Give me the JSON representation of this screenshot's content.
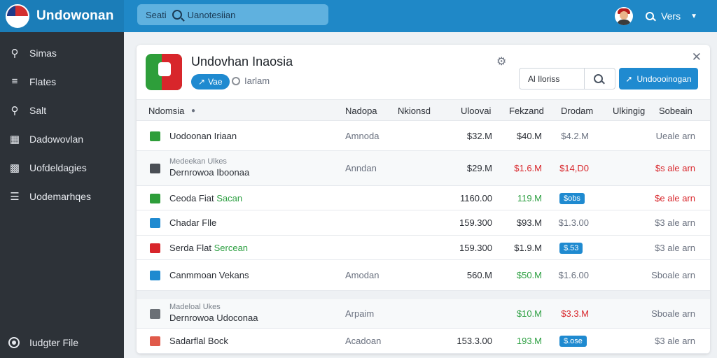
{
  "app": {
    "brand": "Undowonan"
  },
  "search": {
    "label": "Seati",
    "placeholder": "Uanotesiian"
  },
  "topbar": {
    "vers_label": "Vers"
  },
  "sidebar": {
    "items": [
      {
        "label": "Simas",
        "icon": "search-icon"
      },
      {
        "label": "Flates",
        "icon": "bars-icon"
      },
      {
        "label": "Salt",
        "icon": "key-icon"
      },
      {
        "label": "Dadowovlan",
        "icon": "book-icon"
      },
      {
        "label": "Uofdeldagies",
        "icon": "people-icon"
      },
      {
        "label": "Uodemarhqes",
        "icon": "menu-icon"
      }
    ],
    "footer": "Iudgter File"
  },
  "panel": {
    "title": "Undovhan Inaosia",
    "vae_button": "Vae",
    "extra_label": "Iarlam",
    "search_placeholder": "Al Iloriss",
    "primary_button": "Undoooinogan"
  },
  "table": {
    "columns": [
      "Ndomsia",
      "Nadopa",
      "Nkionsd",
      "Uloovai",
      "Fekzand",
      "Drodam",
      "Ulkingig",
      "Sobeain"
    ],
    "rows": [
      {
        "icon": "flag-icon",
        "icon_color": "#2e9e3a",
        "name": "Uodoonan",
        "name_hl": "Iriaan",
        "sub": "",
        "src": "Amnoda",
        "v1": "$32.M",
        "v2": "$40.M",
        "v2_class": "num",
        "v3": "$4.2.M",
        "v3_pill": false,
        "v3_class": "grey",
        "status": "Ueale arn",
        "status_red": false
      },
      {
        "icon": "square-icon",
        "icon_color": "#4a4f55",
        "name": "Dernrowoa Iboonaa",
        "name_hl": "",
        "sub": "Medeekan Ulkes",
        "src": "Anndan",
        "v1": "$29.M",
        "v2": "$1.6.M",
        "v2_class": "red",
        "v3": "$14,D0",
        "v3_pill": false,
        "v3_class": "red",
        "status": "$s ale arn",
        "status_red": true
      },
      {
        "icon": "flag-icon",
        "icon_color": "#2e9e3a",
        "name": "Ceoda Fiat",
        "name_hl": "Sacan",
        "sub": "",
        "src": "",
        "v1": "1160.00",
        "v2": "119.M",
        "v2_class": "green",
        "v3": "$obs",
        "v3_pill": true,
        "v3_class": "",
        "status": "$e ale arn",
        "status_red": true
      },
      {
        "icon": "image-icon",
        "icon_color": "#1f8ad0",
        "name": "Chadar Flle",
        "name_hl": "",
        "sub": "",
        "src": "",
        "v1": "159.300",
        "v2": "$93.M",
        "v2_class": "num",
        "v3": "$1.3.00",
        "v3_pill": false,
        "v3_class": "grey",
        "status": "$3 ale arn",
        "status_red": false
      },
      {
        "icon": "circle-icon",
        "icon_color": "#d8262b",
        "name": "Serda Flat",
        "name_hl": "Sercean",
        "sub": "",
        "src": "",
        "v1": "159.300",
        "v2": "$1.9.M",
        "v2_class": "num",
        "v3": "$.53",
        "v3_pill": true,
        "v3_class": "",
        "status": "$3 ale arn",
        "status_red": false
      },
      {
        "icon": "card-icon",
        "icon_color": "#1f8ad0",
        "name": "Canmmoan Vekans",
        "name_hl": "",
        "sub": "",
        "src": "Amodan",
        "v1": "560.M",
        "v2": "$50.M",
        "v2_class": "green",
        "v3": "$1.6.00",
        "v3_pill": false,
        "v3_class": "grey",
        "status": "Sboale arn",
        "status_red": false
      },
      {
        "icon": "square-icon",
        "icon_color": "#6b7076",
        "name": "Dernrowoa Udoconaa",
        "name_hl": "",
        "sub": "Madeloal Ukes",
        "src": "Arpaim",
        "v1": "",
        "v2": "$10.M",
        "v2_class": "green",
        "v3": "$3.3.M",
        "v3_pill": false,
        "v3_class": "red",
        "status": "Sboale arn",
        "status_red": false
      },
      {
        "icon": "square-icon",
        "icon_color": "#e05a4a",
        "name": "Sadarflal Bock",
        "name_hl": "",
        "sub": "",
        "src": "Acadoan",
        "v1": "153.3.00",
        "v2": "193.M",
        "v2_class": "green",
        "v3": "$.ose",
        "v3_pill": true,
        "v3_class": "",
        "status": "$3 ale arn",
        "status_red": false
      }
    ]
  }
}
